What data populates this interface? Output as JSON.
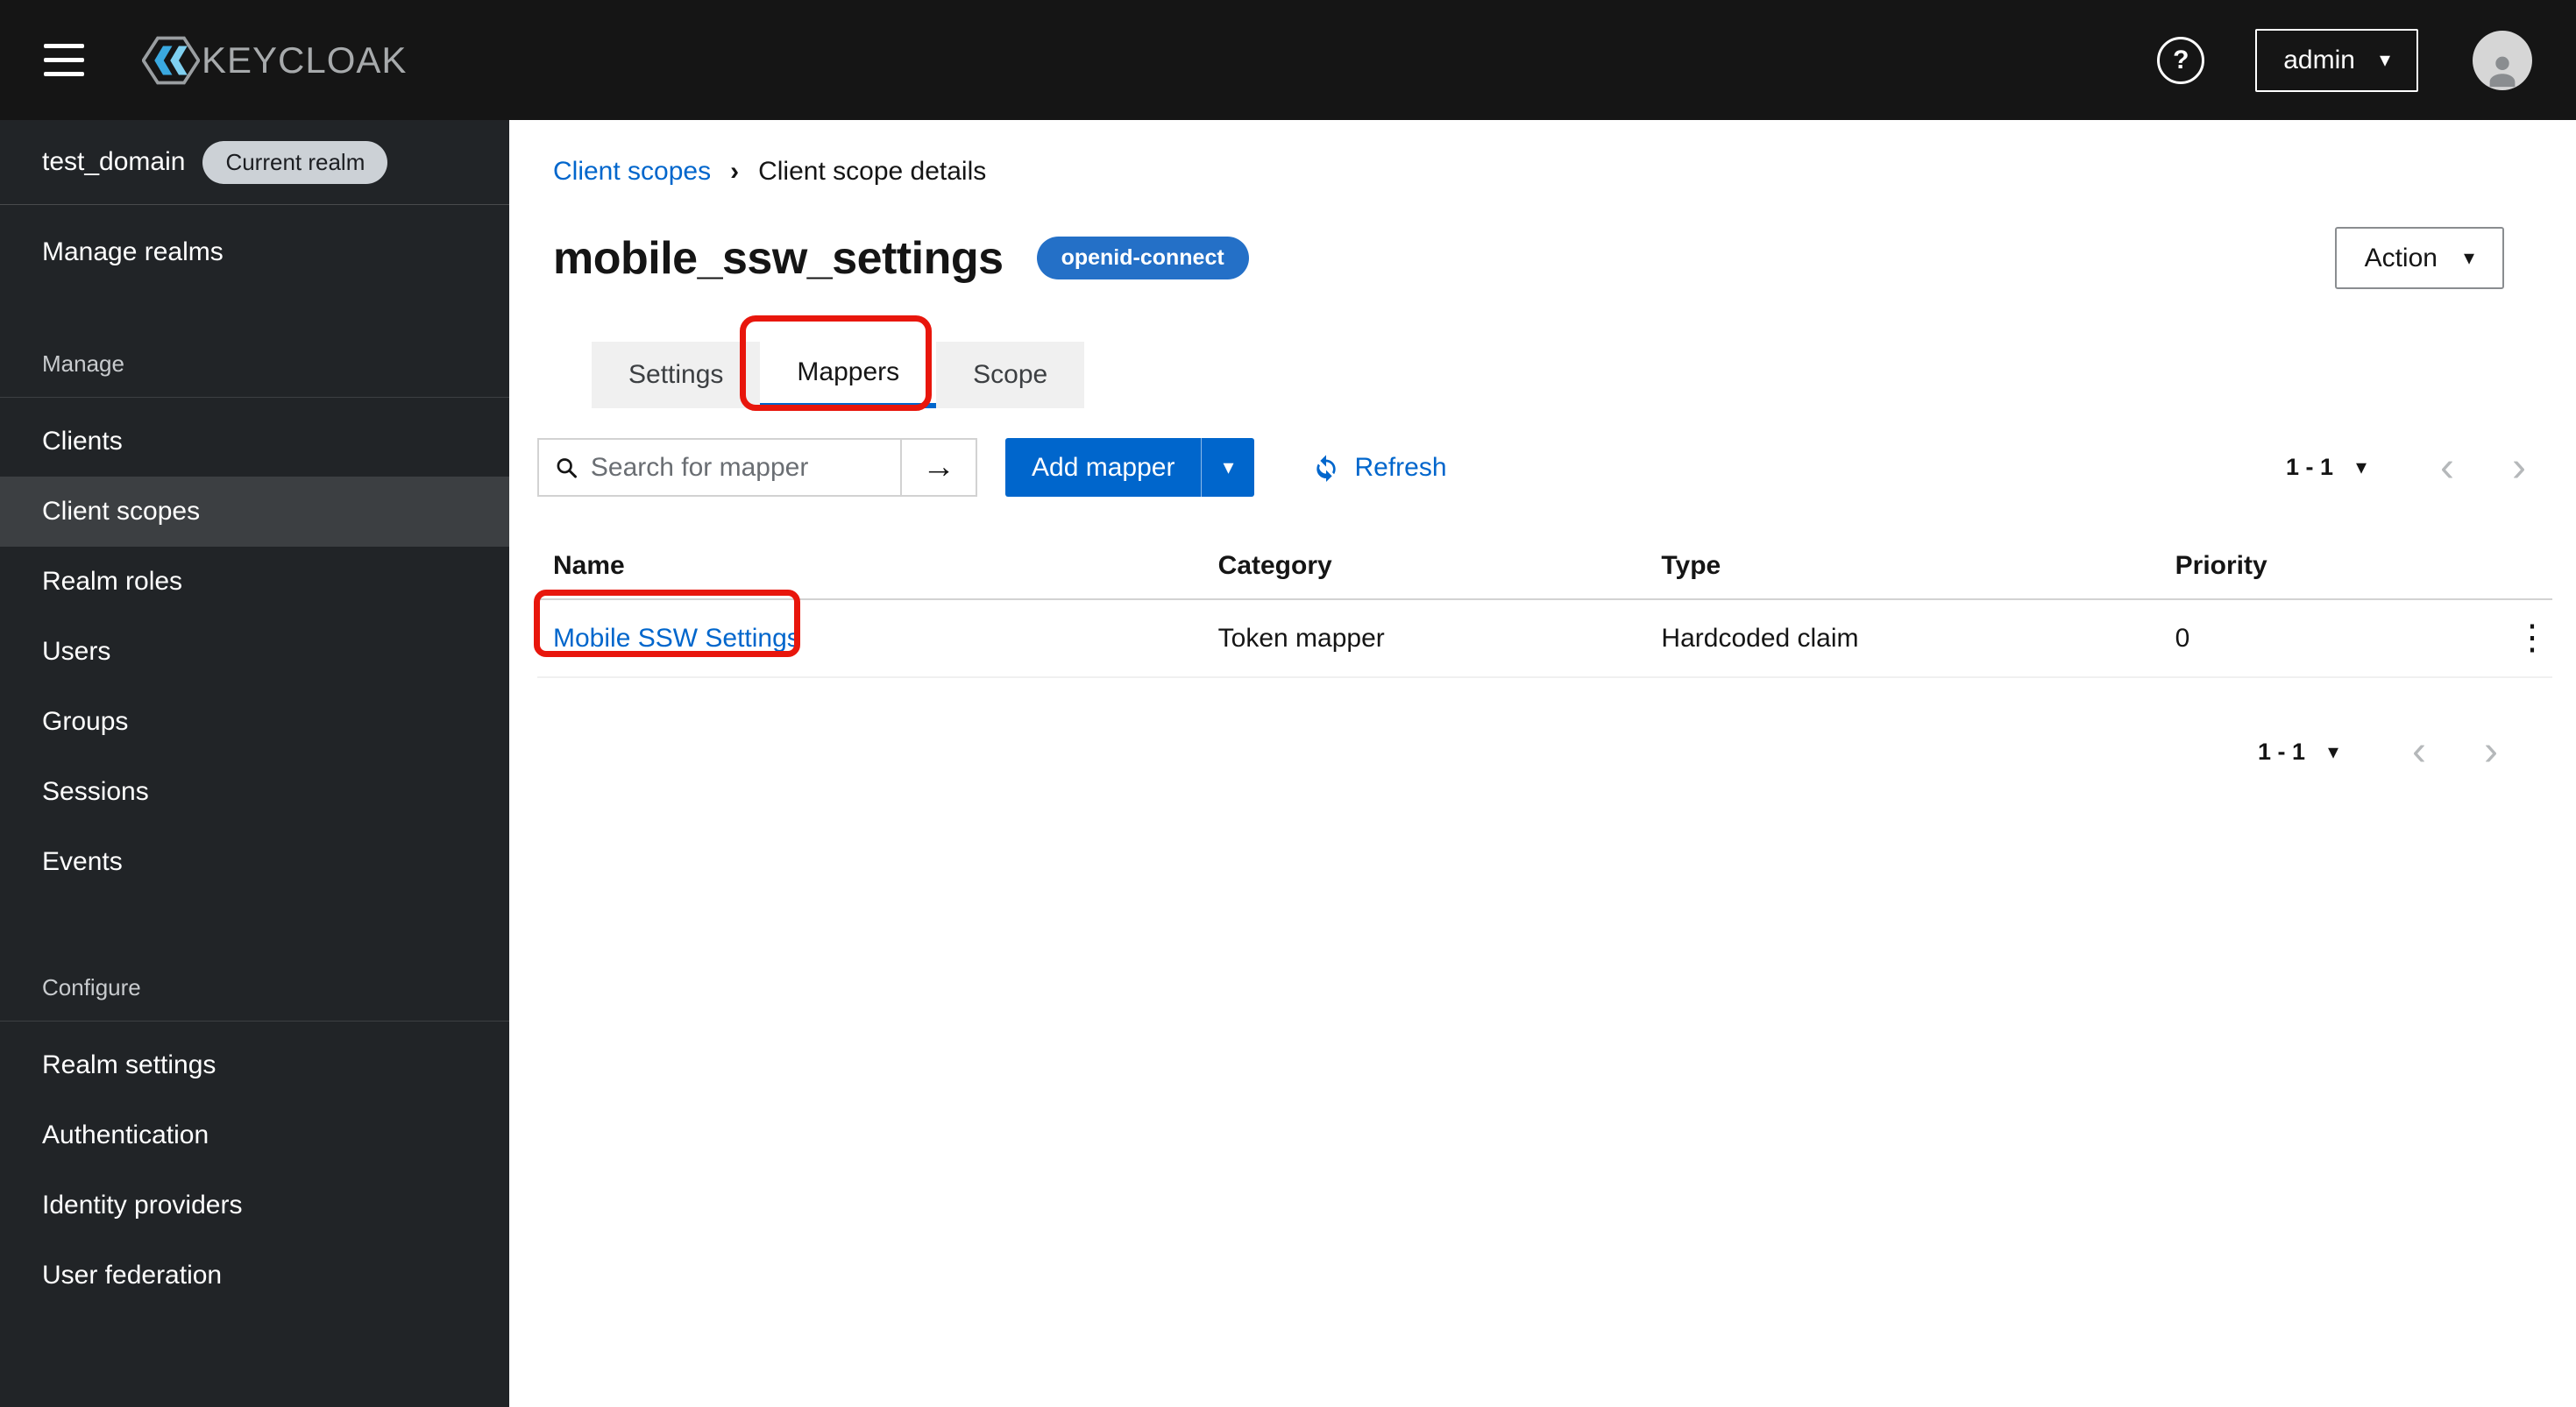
{
  "colors": {
    "accent": "#0066cc",
    "topbar_bg": "#151515",
    "sidebar_bg": "#212427",
    "sidebar_selected_bg": "#3c3f42",
    "badge_bg": "#2470c7",
    "annotation_red": "#e8160c"
  },
  "topbar": {
    "brand": "KEYCLOAK",
    "help_icon": "?",
    "user": {
      "label": "admin"
    }
  },
  "sidebar": {
    "realm": {
      "name": "test_domain",
      "badge": "Current realm"
    },
    "manage_realms_label": "Manage realms",
    "sections": [
      {
        "label": "Manage",
        "items": [
          "Clients",
          "Client scopes",
          "Realm roles",
          "Users",
          "Groups",
          "Sessions",
          "Events"
        ],
        "selected": "Client scopes"
      },
      {
        "label": "Configure",
        "items": [
          "Realm settings",
          "Authentication",
          "Identity providers",
          "User federation"
        ]
      }
    ]
  },
  "breadcrumb": {
    "link": "Client scopes",
    "current": "Client scope details"
  },
  "page": {
    "title": "mobile_ssw_settings",
    "badge": "openid-connect",
    "action": "Action"
  },
  "tabs": [
    {
      "label": "Settings"
    },
    {
      "label": "Mappers"
    },
    {
      "label": "Scope"
    }
  ],
  "toolbar": {
    "search_placeholder": "Search for mapper",
    "search_submit_icon": "arrow-right",
    "add_mapper": "Add mapper",
    "refresh": "Refresh",
    "pagination": {
      "range": "1 - 1"
    }
  },
  "table": {
    "headers": [
      "Name",
      "Category",
      "Type",
      "Priority"
    ],
    "rows": [
      {
        "name": "Mobile SSW Settings",
        "category": "Token mapper",
        "type": "Hardcoded claim",
        "priority": "0"
      }
    ]
  },
  "footer_pagination": {
    "range": "1 - 1"
  }
}
